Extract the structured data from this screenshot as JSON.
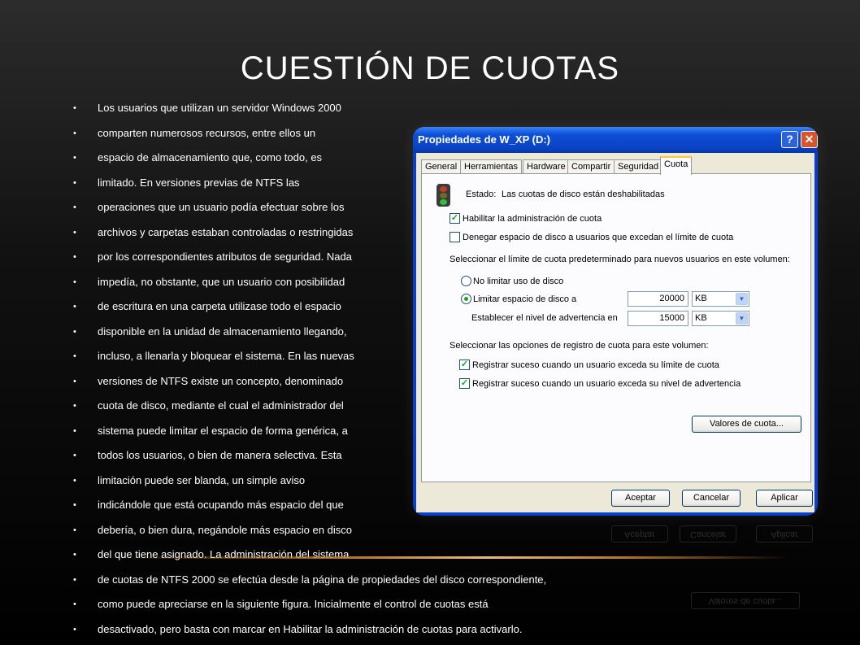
{
  "slide": {
    "title": "CUESTIÓN DE CUOTAS",
    "bullets": [
      "Los usuarios que utilizan un servidor Windows 2000",
      "comparten numerosos recursos, entre ellos un",
      "espacio de almacenamiento que, como todo, es",
      "limitado. En versiones previas de NTFS las",
      "operaciones que un usuario podía efectuar sobre los",
      "archivos y carpetas estaban controladas o restringidas",
      "por los correspondientes atributos de seguridad. Nada",
      "impedía, no obstante, que un usuario con posibilidad",
      "de escritura en una carpeta utilizase todo el espacio",
      "disponible en la unidad de almacenamiento llegando,",
      "incluso, a llenarla y bloquear el sistema. En las nuevas",
      "versiones de NTFS existe un concepto, denominado",
      "cuota de disco, mediante el cual el administrador del",
      "sistema puede limitar el espacio de forma genérica, a",
      "todos los usuarios, o bien de manera selectiva. Esta",
      "limitación puede ser blanda, un simple aviso",
      "indicándole que está ocupando más espacio del que",
      "debería, o bien dura, negándole más espacio en disco",
      "del que tiene asignado. La administración del sistema",
      "de cuotas de NTFS 2000 se efectúa desde la página de propiedades del disco correspondiente,",
      "como puede apreciarse en la siguiente figura. Inicialmente el control de cuotas está",
      "desactivado, pero basta con marcar en Habilitar la administración de cuotas para activarlo."
    ]
  },
  "dialog": {
    "title": "Propiedades de W_XP (D:)",
    "help_glyph": "?",
    "close_glyph": "✕",
    "tabs": [
      "General",
      "Herramientas",
      "Hardware",
      "Compartir",
      "Seguridad",
      "Cuota"
    ],
    "active_tab": "Cuota",
    "status_label": "Estado:",
    "status_value": "Las cuotas de disco están deshabilitadas",
    "enable_quota": {
      "label": "Habilitar la administración de cuota",
      "checked": true
    },
    "deny_space": {
      "label": "Denegar espacio de disco a usuarios que excedan el límite de cuota",
      "checked": false
    },
    "default_limit_heading": "Seleccionar el límite de cuota predeterminado para nuevos usuarios en este volumen:",
    "no_limit": {
      "label": "No limitar uso de disco",
      "selected": false
    },
    "limit_to": {
      "label": "Limitar espacio de disco a",
      "selected": true,
      "value": "20000",
      "unit": "KB"
    },
    "warning_level": {
      "label": "Establecer el nivel de advertencia en",
      "value": "15000",
      "unit": "KB"
    },
    "logging_heading": "Seleccionar las opciones de registro de cuota para este volumen:",
    "log_limit": {
      "label": "Registrar suceso cuando un usuario exceda su límite de cuota",
      "checked": true
    },
    "log_warning": {
      "label": "Registrar suceso cuando un usuario exceda su nivel de advertencia",
      "checked": true
    },
    "quota_entries_button": "Valores de cuota...",
    "ok_button": "Aceptar",
    "cancel_button": "Cancelar",
    "apply_button": "Aplicar",
    "check_glyph": "✓",
    "dropdown_glyph": "▼"
  },
  "colors": {
    "titlebar": "#0a43c4",
    "dialog_face": "#ece9d8",
    "active_tab_accent": "#ffc83c",
    "checkmark": "#21a121",
    "reflection_line": "#c8842a"
  }
}
